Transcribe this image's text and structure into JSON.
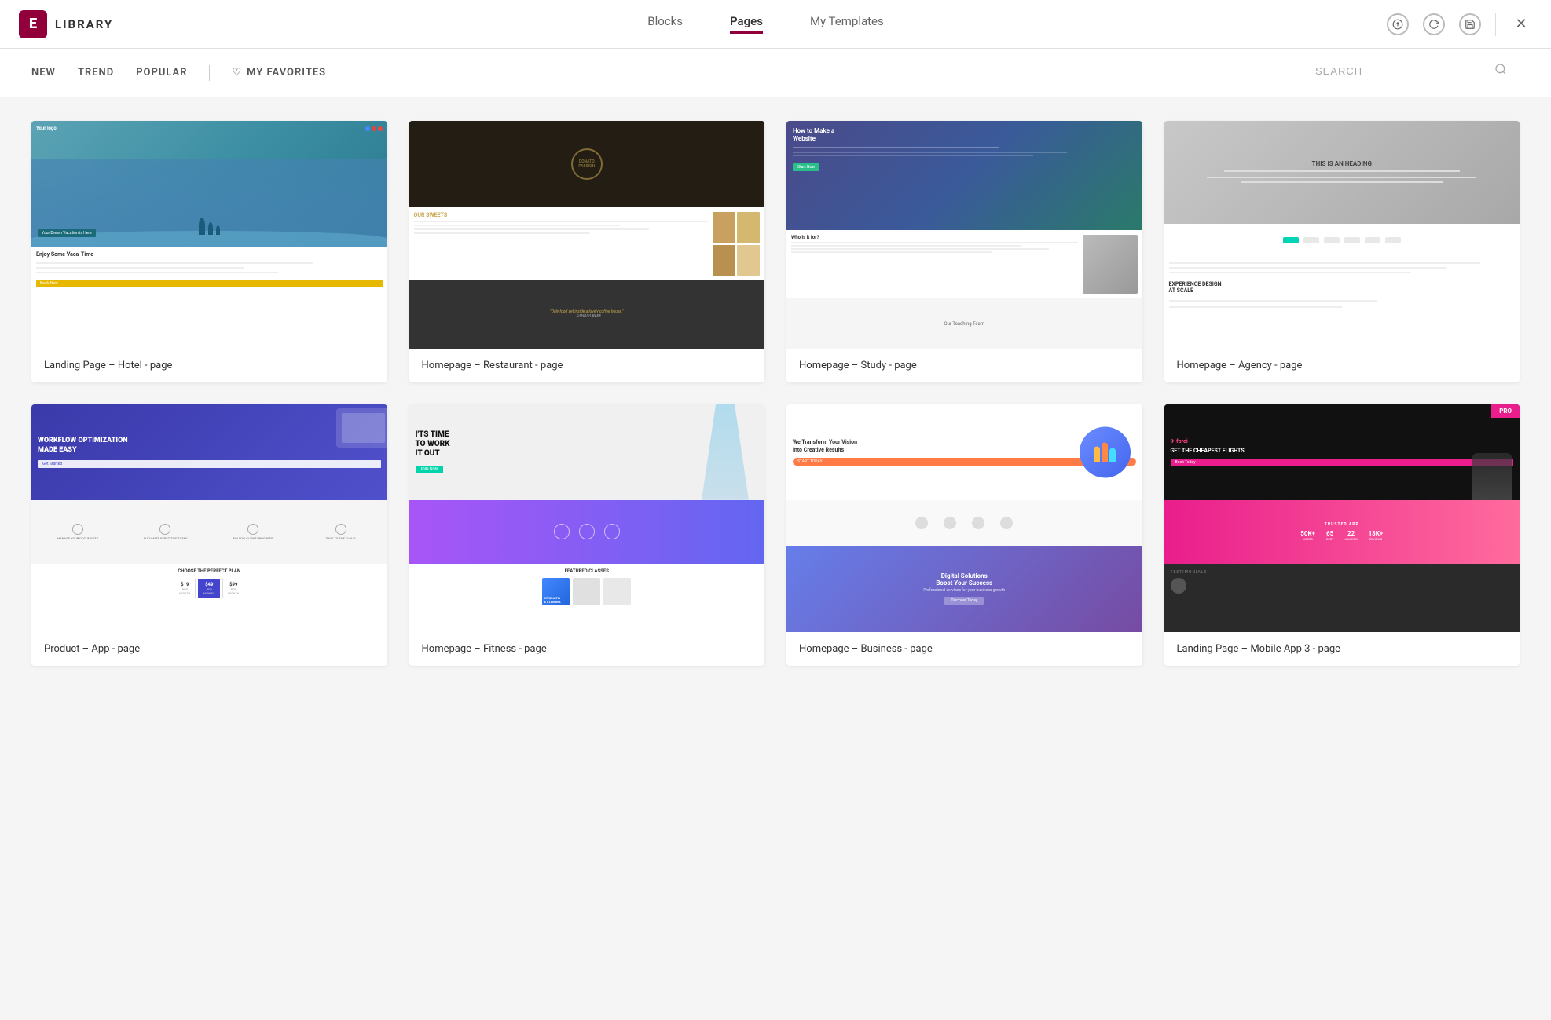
{
  "header": {
    "logo_letter": "E",
    "logo_text": "LIBRARY",
    "tabs": [
      {
        "id": "blocks",
        "label": "Blocks",
        "active": false
      },
      {
        "id": "pages",
        "label": "Pages",
        "active": true
      },
      {
        "id": "my-templates",
        "label": "My Templates",
        "active": false
      }
    ],
    "actions": {
      "upload_label": "↑",
      "refresh_label": "↺",
      "save_label": "⬜",
      "close_label": "✕"
    }
  },
  "filter_bar": {
    "items": [
      {
        "id": "new",
        "label": "NEW",
        "active": false
      },
      {
        "id": "trend",
        "label": "TREND",
        "active": false
      },
      {
        "id": "popular",
        "label": "POPULAR",
        "active": false
      }
    ],
    "favorites_label": "MY FAVORITES",
    "search_placeholder": "SEARCH"
  },
  "cards": [
    {
      "id": "hotel",
      "label": "Landing Page – Hotel - page",
      "preview_type": "hotel"
    },
    {
      "id": "restaurant",
      "label": "Homepage – Restaurant - page",
      "preview_type": "restaurant"
    },
    {
      "id": "study",
      "label": "Homepage – Study - page",
      "preview_type": "study"
    },
    {
      "id": "agency",
      "label": "Homepage – Agency - page",
      "preview_type": "agency"
    },
    {
      "id": "app",
      "label": "Product – App - page",
      "preview_type": "app"
    },
    {
      "id": "fitness",
      "label": "Homepage – Fitness - page",
      "preview_type": "fitness"
    },
    {
      "id": "business",
      "label": "Homepage – Business - page",
      "preview_type": "business"
    },
    {
      "id": "mobile",
      "label": "Landing Page – Mobile App 3 - page",
      "preview_type": "mobile",
      "pro": true
    }
  ],
  "colors": {
    "accent": "#92003b",
    "active_tab_underline": "#92003b"
  }
}
